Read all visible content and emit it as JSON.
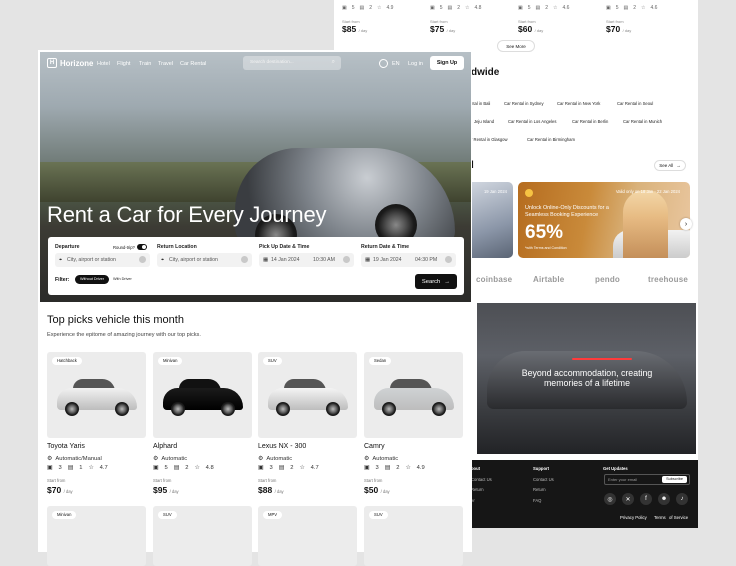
{
  "back_cards": [
    {
      "seats": "5",
      "bags": "2",
      "rating": "4.9",
      "from": "Start from",
      "price": "$85",
      "unit": "/ day"
    },
    {
      "seats": "5",
      "bags": "2",
      "rating": "4.8",
      "from": "Start from",
      "price": "$75",
      "unit": "/ day"
    },
    {
      "seats": "5",
      "bags": "2",
      "rating": "4.6",
      "from": "Start from",
      "price": "$60",
      "unit": "/ day"
    },
    {
      "seats": "5",
      "bags": "2",
      "rating": "4.6",
      "from": "Start from",
      "price": "$70",
      "unit": "/ day"
    }
  ],
  "see_more": "See More",
  "worldwide_fragment": "dwide",
  "rent_links": [
    "ntal in Bali",
    "Car Rental in Sydney",
    "Car Rental in New York",
    "Car Rental in Seoul",
    "Jeju Island",
    "Car Rental in Los Angeles",
    "Car Rental in Berlin",
    "Car Rental in Munich",
    "r Rental in Glasgow",
    "Car Rental in Birmingham"
  ],
  "promo_fragment": "l",
  "see_all": "See All",
  "promo1": {
    "date": "19 Jan 2024"
  },
  "promo2": {
    "date": "Valid only on 18 Jan - 22 Jan 2024",
    "title": "Unlock Online-Only Discounts for a Seamless Booking Experience",
    "percent": "65%",
    "terms": "*with Terms and Condition"
  },
  "partner_logos": [
    "coinbase",
    "Airtable",
    "pendo",
    "treehouse"
  ],
  "hero2_tagline": "Beyond accommodation, creating memories of a lifetime",
  "footer": {
    "col1_title": "bout",
    "col1_items": [
      "Contact Us",
      "Return",
      "er"
    ],
    "col2_title": "Support",
    "col2_items": [
      "Contact Us",
      "Return",
      "FAQ"
    ],
    "col3_title": "Get Updates",
    "email_placeholder": "Enter your email",
    "subscribe": "Subscribe",
    "privacy": "Privacy Policy",
    "terms": "Terms",
    "service": "of Service"
  },
  "nav": {
    "brand": "Horizone",
    "links": [
      "Hotel",
      "Flight",
      "Train",
      "Travel",
      "Car Rental"
    ],
    "search_placeholder": "Search destination...",
    "lang": "EN",
    "login": "Log in",
    "signup": "Sign Up"
  },
  "hero": {
    "headline": "Rent a Car for Every Journey"
  },
  "booking": {
    "departure_label": "Departure",
    "roundtrip_label": "Round-trip?",
    "return_location_label": "Return Location",
    "pickup_label": "Pick Up Date & Time",
    "return_dt_label": "Return Date & Time",
    "city_placeholder": "City, airport or station",
    "city_placeholder2": "City, airport or station",
    "pickup_date": "14 Jan 2024",
    "pickup_time": "10:30 AM",
    "return_date": "19 Jan 2024",
    "return_time": "04:30 PM",
    "filter_label": "Filter:",
    "filter_on": "Without Driver",
    "filter_off": "With Driver",
    "search_btn": "Search"
  },
  "section": {
    "title": "Top picks vehicle this month",
    "subtitle": "Experience the epitome of amazing journey with our top picks."
  },
  "cars": [
    {
      "type": "Hatchback",
      "name": "Toyota Yaris",
      "spec": "Automatic/Manual",
      "seats": "3",
      "bags": "1",
      "rating": "4.7",
      "from": "Start from",
      "price": "$70",
      "unit": "/ day",
      "color": "#f1f1f1"
    },
    {
      "type": "Minivan",
      "name": "Alphard",
      "spec": "Automatic",
      "seats": "5",
      "bags": "2",
      "rating": "4.8",
      "from": "Start from",
      "price": "$95",
      "unit": "/ day",
      "color": "#1b1b1b"
    },
    {
      "type": "SUV",
      "name": "Lexus NX - 300",
      "spec": "Automatic",
      "seats": "3",
      "bags": "2",
      "rating": "4.7",
      "from": "Start from",
      "price": "$88",
      "unit": "/ day",
      "color": "#f4f4f4"
    },
    {
      "type": "Sedan",
      "name": "Camry",
      "spec": "Automatic",
      "seats": "3",
      "bags": "2",
      "rating": "4.9",
      "from": "Start from",
      "price": "$50",
      "unit": "/ day",
      "color": "#cfd2d4"
    }
  ],
  "cars_row2": [
    {
      "type": "Minivan"
    },
    {
      "type": "SUV"
    },
    {
      "type": "MPV"
    },
    {
      "type": "SUV"
    }
  ]
}
